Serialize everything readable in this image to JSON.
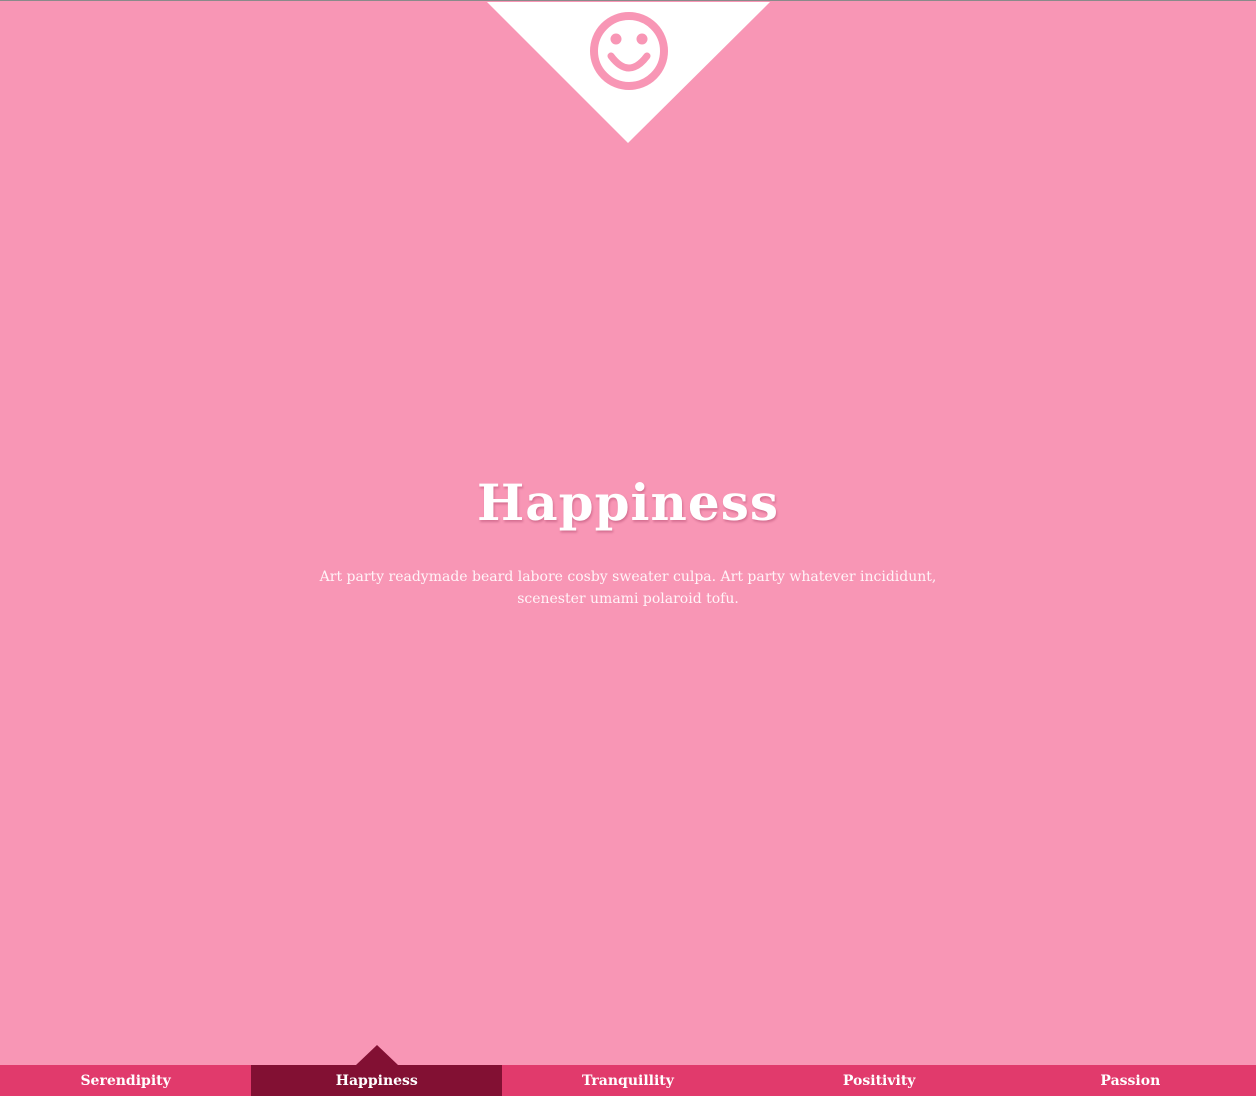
{
  "logo": {
    "icon": "smiley-face-icon",
    "color": "#f896b5",
    "background": "#ffffff"
  },
  "hero": {
    "title": "Happiness",
    "text": "Art party readymade beard labore cosby sweater culpa. Art party whatever incididunt, scenester umami polaroid tofu."
  },
  "nav": {
    "items": [
      {
        "label": "Serendipity",
        "active": false
      },
      {
        "label": "Happiness",
        "active": true
      },
      {
        "label": "Tranquillity",
        "active": false
      },
      {
        "label": "Positivity",
        "active": false
      },
      {
        "label": "Passion",
        "active": false
      }
    ]
  },
  "colors": {
    "page_background": "#f896b5",
    "nav_background": "#e13a6c",
    "nav_active": "#821033",
    "text": "#ffffff"
  }
}
